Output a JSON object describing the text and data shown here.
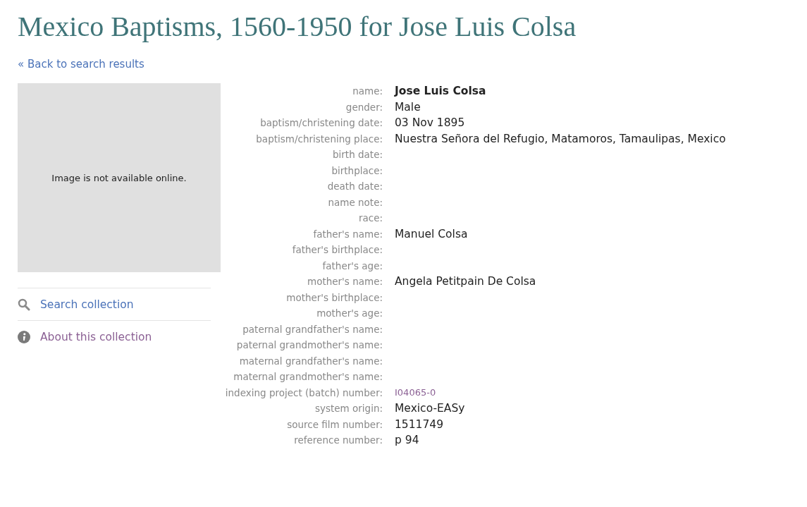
{
  "title": "Mexico Baptisms, 1560-1950 for Jose Luis Colsa",
  "back_link": "« Back to search results",
  "image_panel": {
    "message": "Image is not available online."
  },
  "sidebar": {
    "items": [
      {
        "label": "Search collection",
        "kind": "search",
        "visited": false
      },
      {
        "label": "About this collection",
        "kind": "info",
        "visited": true
      }
    ]
  },
  "record": {
    "fields": [
      {
        "label": "name:",
        "value": "Jose Luis Colsa",
        "kind": "bold"
      },
      {
        "label": "gender:",
        "value": "Male",
        "kind": "text"
      },
      {
        "label": "baptism/christening date:",
        "value": "03 Nov 1895",
        "kind": "text"
      },
      {
        "label": "baptism/christening place:",
        "value": "Nuestra Señora del Refugio, Matamoros, Tamaulipas, Mexico",
        "kind": "text"
      },
      {
        "label": "birth date:"
      },
      {
        "label": "birthplace:"
      },
      {
        "label": "death date:"
      },
      {
        "label": "name note:"
      },
      {
        "label": "race:"
      },
      {
        "label": "father's name:",
        "value": "Manuel Colsa",
        "kind": "text"
      },
      {
        "label": "father's birthplace:"
      },
      {
        "label": "father's age:"
      },
      {
        "label": "mother's name:",
        "value": "Angela Petitpain De Colsa",
        "kind": "text"
      },
      {
        "label": "mother's birthplace:"
      },
      {
        "label": "mother's age:"
      },
      {
        "label": "paternal grandfather's name:"
      },
      {
        "label": "paternal grandmother's name:"
      },
      {
        "label": "maternal grandfather's name:"
      },
      {
        "label": "maternal grandmother's name:"
      },
      {
        "label": "indexing project (batch) number:",
        "value": "I04065-0",
        "kind": "link"
      },
      {
        "label": "system origin:",
        "value": "Mexico-EASy",
        "kind": "text"
      },
      {
        "label": "source film number:",
        "value": "1511749",
        "kind": "text"
      },
      {
        "label": "reference number:",
        "value": "p 94",
        "kind": "text"
      }
    ]
  }
}
